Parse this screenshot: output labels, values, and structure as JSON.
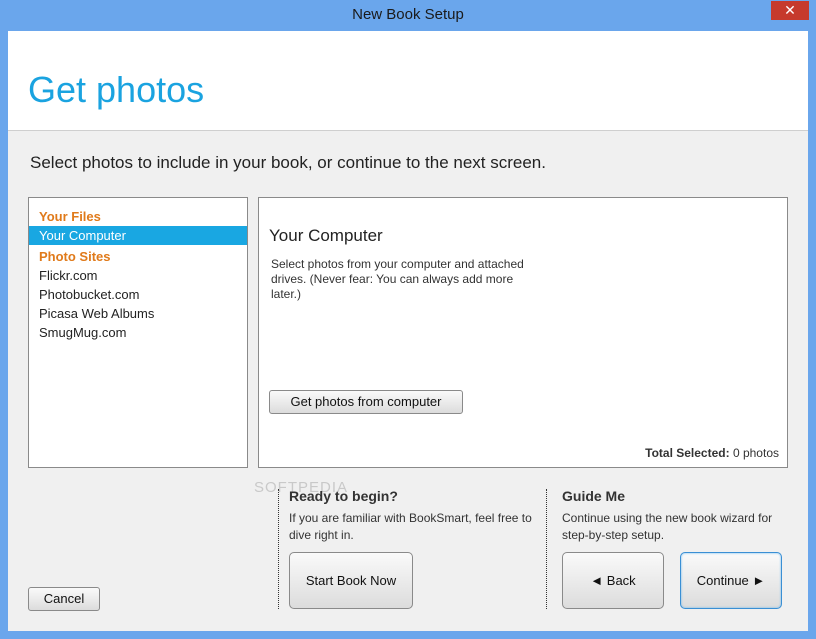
{
  "window": {
    "title": "New Book Setup",
    "close_label": "✕"
  },
  "header": {
    "title": "Get photos"
  },
  "instructions": "Select photos to include in your book, or continue to the next screen.",
  "sources": {
    "groups": [
      {
        "heading": "Your Files",
        "items": [
          "Your Computer"
        ]
      },
      {
        "heading": "Photo Sites",
        "items": [
          "Flickr.com",
          "Photobucket.com",
          "Picasa Web Albums",
          "SmugMug.com"
        ]
      }
    ],
    "selected": "Your Computer"
  },
  "detail": {
    "title": "Your Computer",
    "description": "Select photos from your computer and attached drives. (Never fear: You can always add more later.)",
    "action_label": "Get photos from computer",
    "total_label": "Total Selected:",
    "total_value": "0 photos"
  },
  "ready": {
    "heading": "Ready to begin?",
    "text": "If you are familiar with BookSmart, feel free to dive right in.",
    "button_label": "Start Book Now"
  },
  "guide": {
    "heading": "Guide Me",
    "text": "Continue using the new book wizard for step-by-step setup.",
    "back_label": "◄ Back",
    "continue_label": "Continue ►"
  },
  "footer": {
    "cancel_label": "Cancel"
  },
  "watermark": "SOFTPEDIA",
  "colors": {
    "accent": "#1aa3e0",
    "heading_orange": "#e07a1a",
    "selection": "#19a7e2"
  }
}
